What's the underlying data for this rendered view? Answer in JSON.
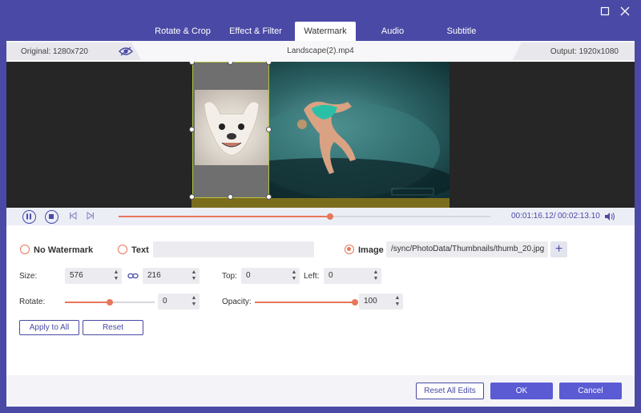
{
  "window": {
    "maximize_icon": "maximize-icon",
    "close_icon": "close-icon"
  },
  "tabs": [
    {
      "label": "Rotate & Crop"
    },
    {
      "label": "Effect & Filter"
    },
    {
      "label": "Watermark",
      "active": true
    },
    {
      "label": "Audio"
    },
    {
      "label": "Subtitle"
    }
  ],
  "info": {
    "original": "Original: 1280x720",
    "filename": "Landscape(2).mp4",
    "output": "Output: 1920x1080"
  },
  "playback": {
    "current_time": "00:01:16.12",
    "separator": "/",
    "total_time": "00:02:13.10",
    "progress_fraction": 0.57
  },
  "watermark": {
    "options": {
      "none_label": "No Watermark",
      "text_label": "Text",
      "image_label": "Image",
      "selected": "image"
    },
    "text_value": "",
    "image_path": "/sync/PhotoData/Thumbnails/thumb_20.jpg",
    "size": {
      "label": "Size:",
      "width": "576",
      "height": "216"
    },
    "top": {
      "label": "Top:",
      "value": "0"
    },
    "left": {
      "label": "Left:",
      "value": "0"
    },
    "rotate": {
      "label": "Rotate:",
      "value": "0",
      "fraction": 0.5
    },
    "opacity": {
      "label": "Opacity:",
      "value": "100",
      "fraction": 1.0
    },
    "apply_all_label": "Apply to All",
    "reset_label": "Reset"
  },
  "footer": {
    "reset_all_label": "Reset All Edits",
    "ok_label": "OK",
    "cancel_label": "Cancel"
  },
  "colors": {
    "accent": "#4a4aa6",
    "orange": "#e8765a",
    "button": "#5b5bd4"
  }
}
